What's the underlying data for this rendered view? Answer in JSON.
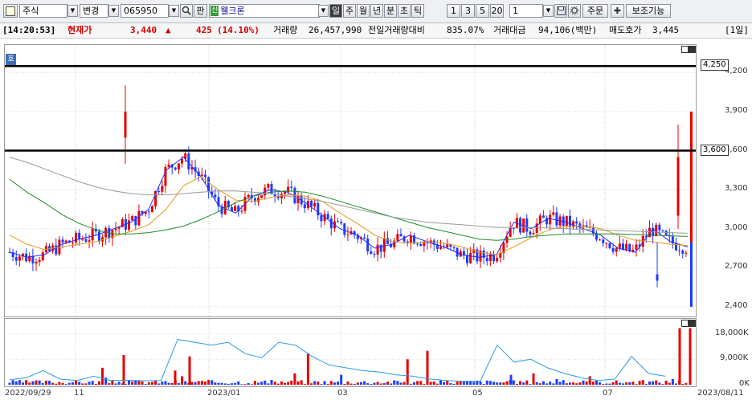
{
  "toolbar": {
    "market_label": "주식",
    "change_label": "변경",
    "code_value": "065950",
    "search_label": "판",
    "new_badge": "신",
    "stock_name": "웰크론",
    "period_buttons": [
      "일",
      "주",
      "월",
      "년",
      "분",
      "초",
      "틱"
    ],
    "interval_buttons": [
      "1",
      "3",
      "5",
      "20"
    ],
    "count_value": "1",
    "order_label": "주문",
    "plus_label": "✚",
    "assist_label": "보조기능"
  },
  "info": {
    "time": "[14:20:53]",
    "price_label": "현재가",
    "price": "3,440",
    "arrow": "▲",
    "change": "425",
    "change_pct": "(14.10%)",
    "volume_label": "거래량",
    "volume": "26,457,990",
    "prev_ratio_label": "전일거래량대비",
    "prev_ratio": "835.07%",
    "amount_label": "거래대금",
    "amount": "94,106(백만)",
    "ask_label": "매도호가",
    "ask": "3,445",
    "period": "[1일]"
  },
  "chart_data": {
    "type": "candlestick",
    "price_axis": {
      "ticks": [
        "4,200",
        "3,900",
        "3,600",
        "3,300",
        "3,000",
        "2,700",
        "2,400"
      ],
      "range": [
        2400,
        4250
      ]
    },
    "volume_axis": {
      "ticks": [
        "18,000K",
        "9,000K",
        "0K"
      ],
      "range": [
        0,
        21000000
      ]
    },
    "x_labels": [
      "2022/09/29",
      "11",
      "2023/01",
      "03",
      "05",
      "07",
      "2023/08/11"
    ],
    "horizontal_lines": [
      {
        "value": 4250,
        "label": "4,250"
      },
      {
        "value": 3600,
        "label": "3,600"
      }
    ],
    "moving_averages": [
      {
        "color": "#2a2aff",
        "points": [
          2820,
          2780,
          2800,
          2880,
          2920,
          2950,
          3000,
          3050,
          3150,
          3450,
          3550,
          3400,
          3180,
          3120,
          3250,
          3300,
          3280,
          3200,
          3100,
          3000,
          2950,
          2850,
          2880,
          2950,
          2900,
          2860,
          2800,
          2780,
          2800,
          3050,
          3000,
          3080,
          3050,
          3000,
          2950,
          2850,
          2820,
          3000,
          2900,
          2860
        ]
      },
      {
        "color": "#e89a1e",
        "points": [
          2950,
          2880,
          2840,
          2860,
          2880,
          2900,
          2940,
          2980,
          3030,
          3150,
          3330,
          3400,
          3300,
          3220,
          3210,
          3240,
          3260,
          3250,
          3210,
          3120,
          3040,
          2950,
          2900,
          2890,
          2900,
          2890,
          2860,
          2820,
          2800,
          2860,
          2930,
          2990,
          3020,
          3020,
          3000,
          2950,
          2910,
          2900,
          2880,
          2870
        ]
      },
      {
        "color": "#1e8c2a",
        "points": [
          3380,
          3280,
          3200,
          3110,
          3040,
          2990,
          2960,
          2960,
          2970,
          2990,
          3020,
          3070,
          3130,
          3200,
          3250,
          3280,
          3290,
          3280,
          3250,
          3210,
          3170,
          3130,
          3090,
          3050,
          3010,
          2980,
          2950,
          2920,
          2910,
          2920,
          2940,
          2950,
          2960,
          2960,
          2960,
          2960,
          2955,
          2950,
          2945,
          2940
        ]
      },
      {
        "color": "#9a9a9a",
        "points": [
          3550,
          3510,
          3460,
          3410,
          3360,
          3320,
          3290,
          3270,
          3260,
          3260,
          3270,
          3280,
          3290,
          3290,
          3280,
          3270,
          3250,
          3230,
          3210,
          3180,
          3150,
          3120,
          3090,
          3070,
          3050,
          3040,
          3030,
          3020,
          3010,
          3010,
          3010,
          3005,
          3000,
          2995,
          2990,
          2985,
          2980,
          2975,
          2970,
          2965
        ]
      }
    ],
    "volume_line": [
      1800000,
      2500000,
      5000000,
      2000000,
      1500000,
      3000000,
      1500000,
      1600000,
      1400000,
      1500000,
      16000000,
      15000000,
      14000000,
      15000000,
      11000000,
      9500000,
      15000000,
      14000000,
      10000000,
      7000000,
      6000000,
      5000000,
      4500000,
      3500000,
      3000000,
      2000000,
      1500000,
      1200000,
      1300000,
      14000000,
      8000000,
      9000000,
      6000000,
      4000000,
      2500000,
      1500000,
      2000000,
      10000000,
      4000000,
      3000000
    ]
  }
}
